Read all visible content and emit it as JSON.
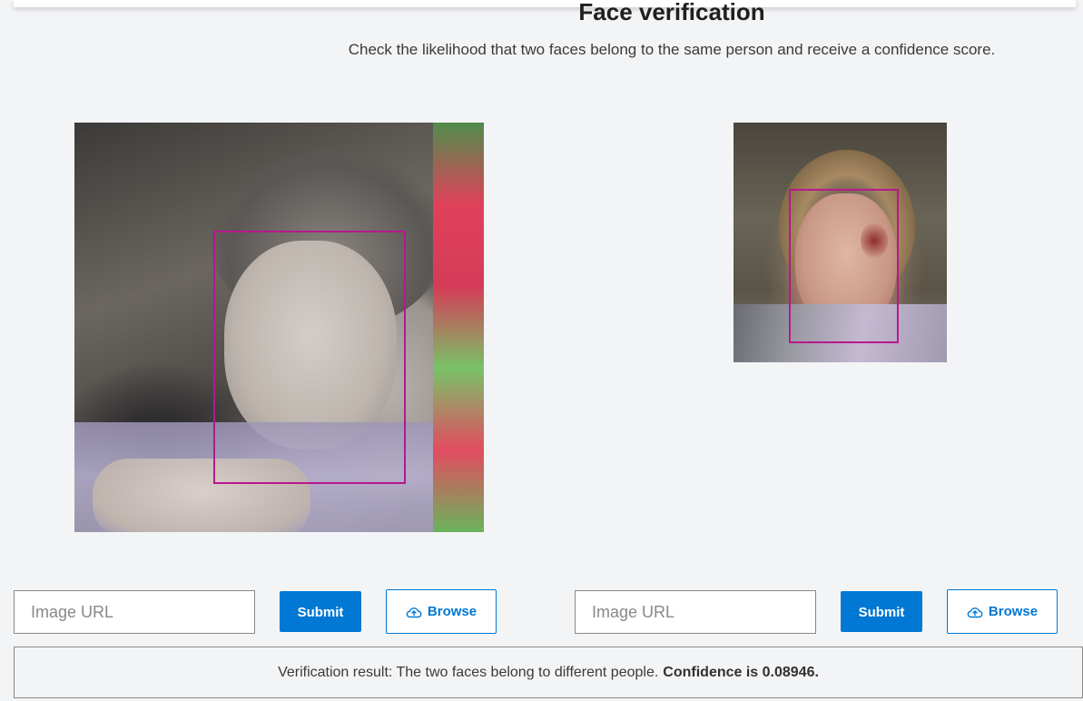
{
  "header": {
    "title": "Face verification",
    "subtitle": "Check the likelihood that two faces belong to the same person and receive a confidence score."
  },
  "left_panel": {
    "url_placeholder": "Image URL",
    "submit_label": "Submit",
    "browse_label": "Browse",
    "browse_icon": "upload-cloud-icon"
  },
  "right_panel": {
    "url_placeholder": "Image URL",
    "submit_label": "Submit",
    "browse_label": "Browse",
    "browse_icon": "upload-cloud-icon"
  },
  "result": {
    "text": "Verification result: The two faces belong to different people.",
    "confidence_text": "Confidence is 0.08946."
  },
  "colors": {
    "accent": "#0078d4",
    "face_box": "#b8178e",
    "background": "#f3f4f6"
  }
}
